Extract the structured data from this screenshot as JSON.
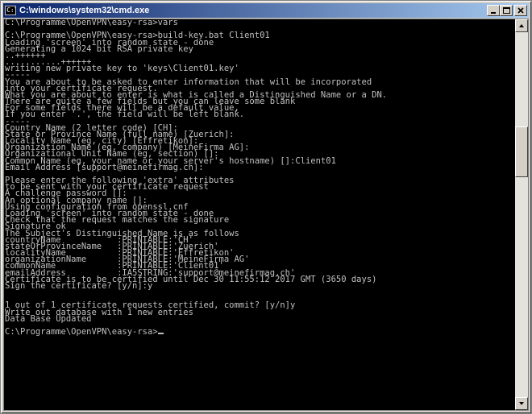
{
  "window": {
    "title": "C:\\windows\\system32\\cmd.exe",
    "icon": "cmd-icon"
  },
  "console": {
    "lines": [
      "C:\\Programme\\OpenVPN\\easy-rsa>vars",
      "",
      "C:\\Programme\\OpenVPN\\easy-rsa>build-key.bat Client01",
      "Loading 'screen' into random state - done",
      "Generating a 1024 bit RSA private key",
      "..++++++",
      "...........++++++",
      "writing new private key to 'keys\\Client01.key'",
      "-----",
      "You are about to be asked to enter information that will be incorporated",
      "into your certificate request.",
      "What you are about to enter is what is called a Distinguished Name or a DN.",
      "There are quite a few fields but you can leave some blank",
      "For some fields there will be a default value,",
      "If you enter '.', the field will be left blank.",
      "-----",
      "Country Name (2 letter code) [CH]:",
      "State or Province Name (full name) [Zuerich]:",
      "Locality Name (eg, city) [Effretikon]:",
      "Organization Name (eg, company) [MeineFirma AG]:",
      "Organizational Unit Name (eg, section) []:",
      "Common Name (eg, your name or your server's hostname) []:Client01",
      "Email Address [support@meinefirmag.ch]:",
      "",
      "Please enter the following 'extra' attributes",
      "to be sent with your certificate request",
      "A challenge password []:",
      "An optional company name []:",
      "Using configuration from openssl.cnf",
      "Loading 'screen' into random state - done",
      "Check that the request matches the signature",
      "Signature ok",
      "The Subject's Distinguished Name is as follows",
      "countryName           :PRINTABLE:'CH'",
      "stateOrProvinceName   :PRINTABLE:'Zuerich'",
      "localityName          :PRINTABLE:'Effretikon'",
      "organizationName      :PRINTABLE:'MeineFirma AG'",
      "commonName            :PRINTABLE:'Client01'",
      "emailAddress          :IA5STRING:'support@meinefirmag.ch'",
      "Certificate is to be certified until Dec 30 11:55:12 2017 GMT (3650 days)",
      "Sign the certificate? [y/n]:y",
      "",
      "",
      "1 out of 1 certificate requests certified, commit? [y/n]y",
      "Write out database with 1 new entries",
      "Data Base Updated",
      "",
      "C:\\Programme\\OpenVPN\\easy-rsa>"
    ],
    "colors": {
      "background": "#000000",
      "text": "#c0c0c0"
    }
  },
  "scrollbar": {
    "position": 0.3,
    "visible_fraction": 0.14
  }
}
